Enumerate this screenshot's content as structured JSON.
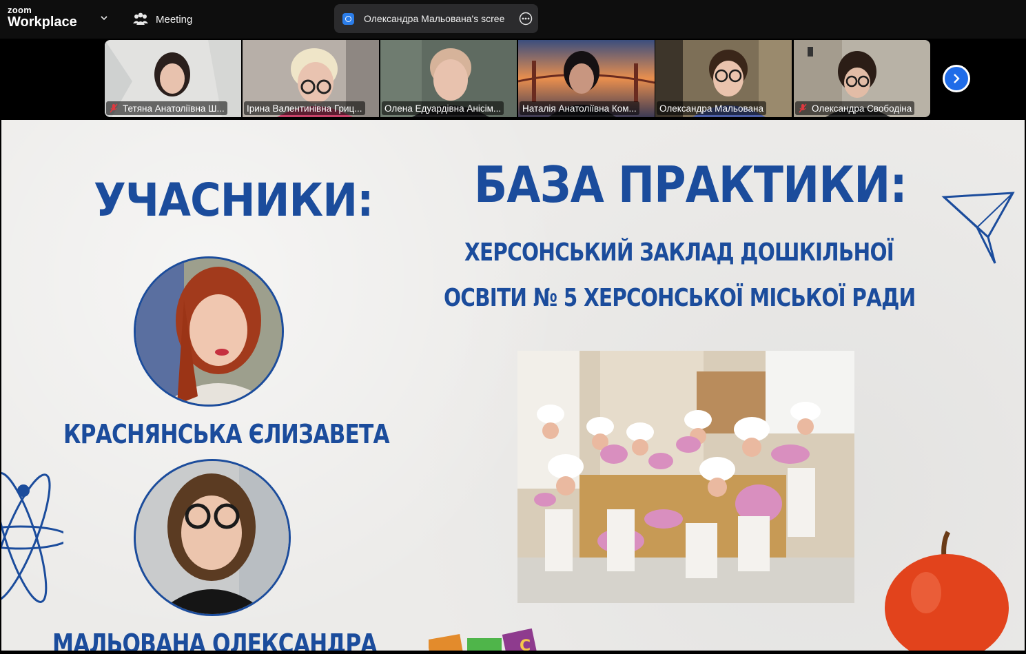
{
  "app": {
    "logo_top": "zoom",
    "logo_bottom": "Workplace",
    "meeting_label": "Meeting",
    "share_label": "Олександра Мальована's scree"
  },
  "participants": [
    {
      "name": "Тетяна Анатоліївна Ш...",
      "muted": true,
      "active": false
    },
    {
      "name": "Ірина Валентинівна Гриц...",
      "muted": false,
      "active": false
    },
    {
      "name": "Олена Едуардівна Анісім...",
      "muted": false,
      "active": false
    },
    {
      "name": "Наталія Анатоліївна Ком...",
      "muted": false,
      "active": false
    },
    {
      "name": "Олександра Мальована",
      "muted": false,
      "active": true
    },
    {
      "name": "Олександра Свободіна",
      "muted": true,
      "active": false
    }
  ],
  "slide": {
    "participants_heading": "УЧАСНИКИ:",
    "base_heading": "БАЗА ПРАКТИКИ:",
    "base_line1": "ХЕРСОНСЬКИЙ ЗАКЛАД ДОШКІЛЬНОЇ",
    "base_line2": "ОСВІТИ № 5 ХЕРСОНСЬКОЇ МІСЬКОЇ РАДИ",
    "student1": "КРАСНЯНСЬКА ЄЛИЗАВЕТА",
    "student2": "МАЛЬОВАНА ОЛЕКСАНДРА"
  },
  "colors": {
    "accent_blue": "#1b4c9c",
    "active_speaker": "#21d39a",
    "zoom_blue": "#1f6ce8",
    "muted_red": "#e0383e"
  }
}
